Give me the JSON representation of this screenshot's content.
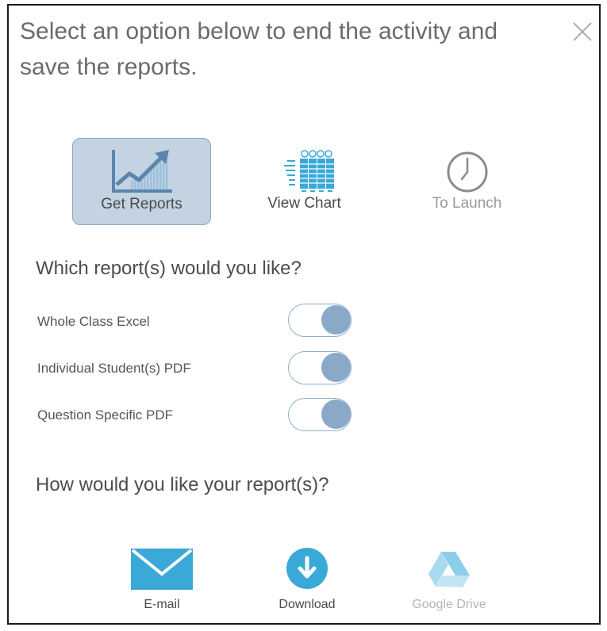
{
  "dialog": {
    "title": "Select an option below to end the activity and save the reports.",
    "close_icon": "close-icon"
  },
  "options": [
    {
      "label": "Get Reports",
      "icon": "line-chart-icon",
      "selected": true
    },
    {
      "label": "View Chart",
      "icon": "results-grid-icon",
      "selected": false
    },
    {
      "label": "To Launch",
      "icon": "clock-icon",
      "selected": false
    }
  ],
  "reports": {
    "heading": "Which report(s) would you like?",
    "items": [
      {
        "label": "Whole Class Excel",
        "enabled": true
      },
      {
        "label": "Individual Student(s) PDF",
        "enabled": true
      },
      {
        "label": "Question Specific PDF",
        "enabled": true
      }
    ]
  },
  "delivery": {
    "heading": "How would you like your report(s)?",
    "items": [
      {
        "label": "E-mail",
        "icon": "envelope-icon"
      },
      {
        "label": "Download",
        "icon": "download-icon"
      },
      {
        "label": "Google Drive",
        "icon": "google-drive-icon"
      }
    ]
  },
  "colors": {
    "accent": "#3aa9d8",
    "selected_bg": "#c3d3e2",
    "toggle_knob": "#8aa9c8"
  }
}
